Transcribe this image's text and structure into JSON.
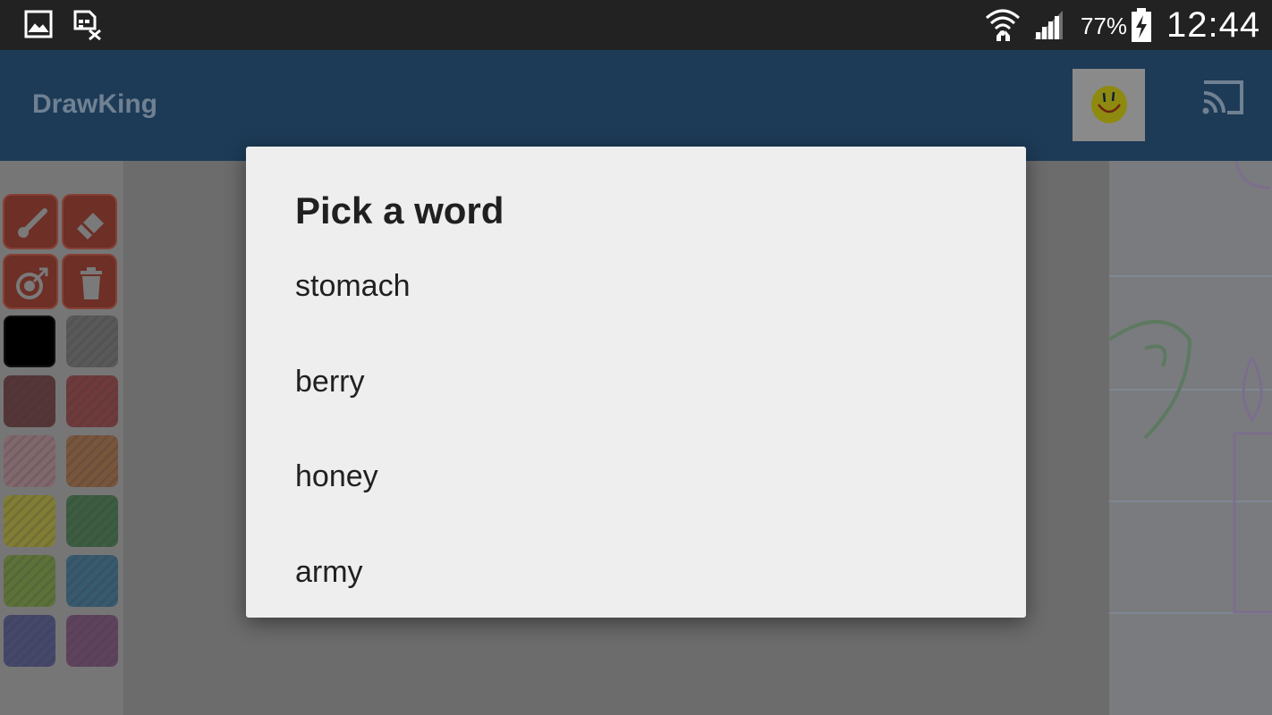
{
  "status_bar": {
    "battery_percent": "77%",
    "time": "12:44",
    "icons": [
      "image-icon",
      "sim-card-off-icon",
      "wifi-icon",
      "cell-signal-icon",
      "battery-charging-icon"
    ]
  },
  "app_bar": {
    "title": "DrawKing",
    "actions": [
      "avatar-smiley-icon",
      "cast-icon"
    ]
  },
  "tools": [
    "brush-icon",
    "eraser-icon",
    "resize-icon",
    "trash-icon"
  ],
  "palette": {
    "colors": [
      "#000000",
      "#434343",
      "#3b0006",
      "#6b0a0c",
      "#8a5d66",
      "#7a3c0d",
      "#8a8300",
      "#0d4a16",
      "#4a6f09",
      "#054468",
      "#1e2263",
      "#4e1b4b"
    ]
  },
  "dialog": {
    "title": "Pick a word",
    "words": [
      "stomach",
      "berry",
      "honey",
      "army"
    ]
  },
  "colors": {
    "status_bar_bg": "#222222",
    "app_bar_bg": "#1d3b57",
    "dialog_bg": "#eeeeee",
    "tool_button": "#6d2f26"
  }
}
